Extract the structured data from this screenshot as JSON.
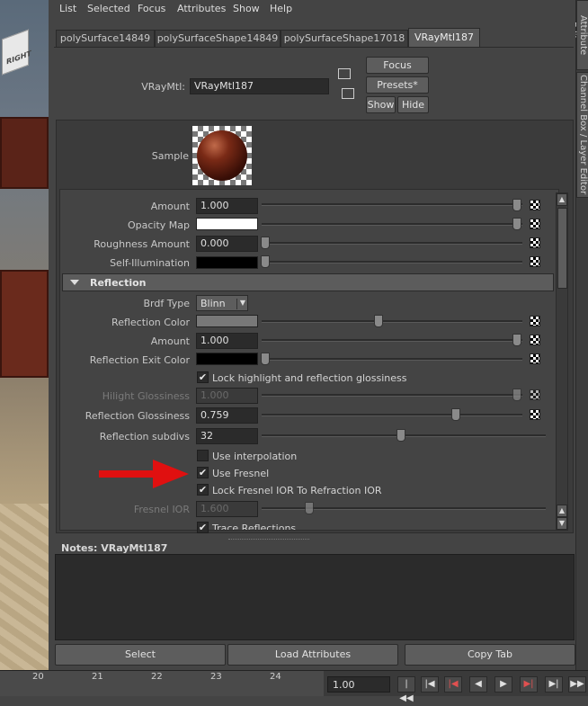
{
  "menu": [
    "List",
    "Selected",
    "Focus",
    "Attributes",
    "Show",
    "Help"
  ],
  "tabs": [
    "polySurface14849",
    "polySurfaceShape14849",
    "polySurfaceShape17018",
    "VRayMtl187"
  ],
  "header": {
    "node_label": "VRayMtl:",
    "node_value": "VRayMtl187",
    "focus_label": "Focus",
    "presets_label": "Presets*",
    "show_label": "Show",
    "hide_label": "Hide"
  },
  "sample": {
    "label": "Sample"
  },
  "rows_top": [
    {
      "label": "Amount",
      "value": "1.000"
    },
    {
      "label": "Opacity Map",
      "value": ""
    },
    {
      "label": "Roughness Amount",
      "value": "0.000"
    },
    {
      "label": "Self-Illumination",
      "value": ""
    }
  ],
  "reflection": {
    "section_title": "Reflection",
    "brdf_label": "Brdf Type",
    "brdf_value": "Blinn",
    "reflection_color_label": "Reflection Color",
    "amount_label": "Amount",
    "amount_value": "1.000",
    "exit_color_label": "Reflection Exit Color",
    "lock_highlight_label": "Lock highlight and reflection glossiness",
    "lock_highlight_checked": true,
    "hilight_label": "Hilight Glossiness",
    "hilight_value": "1.000",
    "refl_gloss_label": "Reflection Glossiness",
    "refl_gloss_value": "0.759",
    "subdivs_label": "Reflection subdivs",
    "subdivs_value": "32",
    "use_interp_label": "Use interpolation",
    "use_interp_checked": false,
    "use_fresnel_label": "Use Fresnel",
    "use_fresnel_checked": true,
    "lock_fresnel_label": "Lock Fresnel IOR To Refraction IOR",
    "lock_fresnel_checked": true,
    "fresnel_ior_label": "Fresnel IOR",
    "fresnel_ior_value": "1.600",
    "trace_label": "Trace Reflections",
    "trace_checked": true
  },
  "notes": {
    "label": "Notes:  VRayMtl187"
  },
  "bottom_buttons": {
    "select": "Select",
    "load": "Load Attributes",
    "copy": "Copy Tab"
  },
  "side_tabs": {
    "attr_editor": "Attribute Editor",
    "channel_box": "Channel Box / Layer Editor"
  },
  "viewport_text": "RIGHT",
  "timeline": {
    "ticks": [
      "20",
      "21",
      "22",
      "23",
      "24"
    ],
    "current_frame": "1.00"
  },
  "colors": {
    "accent_arrow": "#e01010",
    "panel_bg": "#444444"
  }
}
